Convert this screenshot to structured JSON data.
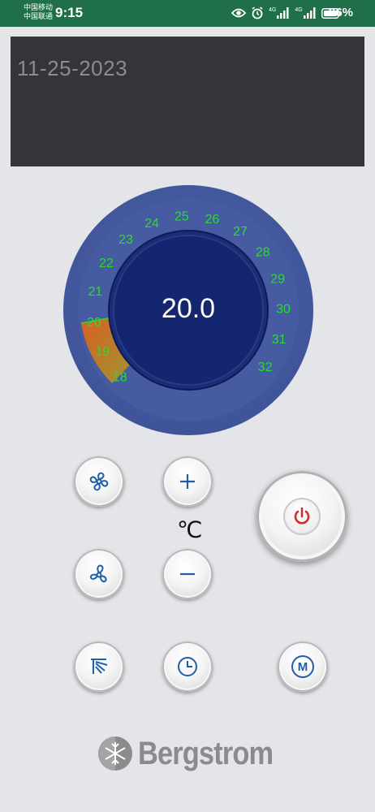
{
  "status_bar": {
    "carrier_1": "中国移动",
    "carrier_2": "中国联通",
    "time": "9:15",
    "network_1": "4G",
    "network_2": "4G",
    "battery": "96%",
    "icons": [
      "eye-icon",
      "alarm-icon",
      "signal-icon",
      "signal-icon",
      "battery-icon"
    ]
  },
  "date_panel": {
    "date": "11-25-2023"
  },
  "dial": {
    "value": "20.0",
    "scale": [
      "18",
      "19",
      "20",
      "21",
      "22",
      "23",
      "24",
      "25",
      "26",
      "27",
      "28",
      "29",
      "30",
      "31",
      "32"
    ],
    "colors": {
      "outer": "#4a5ea4",
      "inner": "#142670",
      "ticks": "#22e028",
      "fill_start": "#d9541e",
      "fill_end": "#9aa22a"
    }
  },
  "controls": {
    "unit": "℃",
    "buttons": [
      "fan-speed-button",
      "plus-button",
      "fan-mode-button",
      "minus-button",
      "swing-button",
      "timer-button",
      "mode-button",
      "power-button"
    ],
    "mode_letter": "M"
  },
  "brand": {
    "name": "Bergstrom"
  }
}
